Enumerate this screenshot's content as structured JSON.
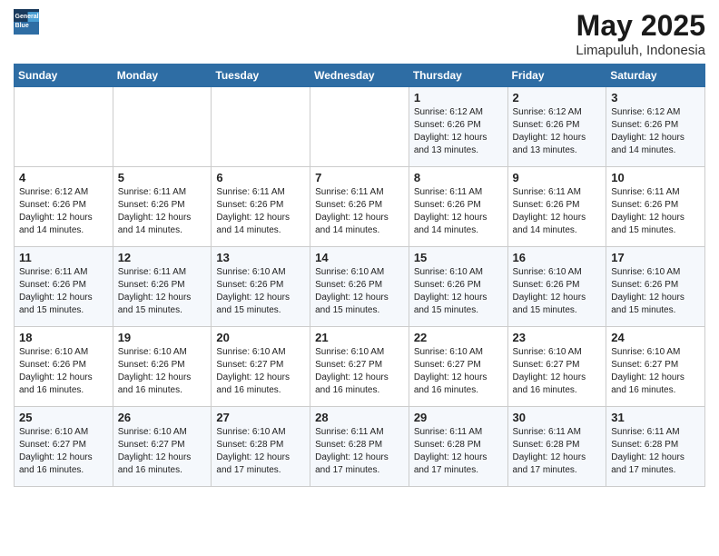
{
  "header": {
    "logo_general": "General",
    "logo_blue": "Blue",
    "month": "May 2025",
    "location": "Limapuluh, Indonesia"
  },
  "days_of_week": [
    "Sunday",
    "Monday",
    "Tuesday",
    "Wednesday",
    "Thursday",
    "Friday",
    "Saturday"
  ],
  "weeks": [
    [
      {
        "day": "",
        "info": ""
      },
      {
        "day": "",
        "info": ""
      },
      {
        "day": "",
        "info": ""
      },
      {
        "day": "",
        "info": ""
      },
      {
        "day": "1",
        "info": "Sunrise: 6:12 AM\nSunset: 6:26 PM\nDaylight: 12 hours\nand 13 minutes."
      },
      {
        "day": "2",
        "info": "Sunrise: 6:12 AM\nSunset: 6:26 PM\nDaylight: 12 hours\nand 13 minutes."
      },
      {
        "day": "3",
        "info": "Sunrise: 6:12 AM\nSunset: 6:26 PM\nDaylight: 12 hours\nand 14 minutes."
      }
    ],
    [
      {
        "day": "4",
        "info": "Sunrise: 6:12 AM\nSunset: 6:26 PM\nDaylight: 12 hours\nand 14 minutes."
      },
      {
        "day": "5",
        "info": "Sunrise: 6:11 AM\nSunset: 6:26 PM\nDaylight: 12 hours\nand 14 minutes."
      },
      {
        "day": "6",
        "info": "Sunrise: 6:11 AM\nSunset: 6:26 PM\nDaylight: 12 hours\nand 14 minutes."
      },
      {
        "day": "7",
        "info": "Sunrise: 6:11 AM\nSunset: 6:26 PM\nDaylight: 12 hours\nand 14 minutes."
      },
      {
        "day": "8",
        "info": "Sunrise: 6:11 AM\nSunset: 6:26 PM\nDaylight: 12 hours\nand 14 minutes."
      },
      {
        "day": "9",
        "info": "Sunrise: 6:11 AM\nSunset: 6:26 PM\nDaylight: 12 hours\nand 14 minutes."
      },
      {
        "day": "10",
        "info": "Sunrise: 6:11 AM\nSunset: 6:26 PM\nDaylight: 12 hours\nand 15 minutes."
      }
    ],
    [
      {
        "day": "11",
        "info": "Sunrise: 6:11 AM\nSunset: 6:26 PM\nDaylight: 12 hours\nand 15 minutes."
      },
      {
        "day": "12",
        "info": "Sunrise: 6:11 AM\nSunset: 6:26 PM\nDaylight: 12 hours\nand 15 minutes."
      },
      {
        "day": "13",
        "info": "Sunrise: 6:10 AM\nSunset: 6:26 PM\nDaylight: 12 hours\nand 15 minutes."
      },
      {
        "day": "14",
        "info": "Sunrise: 6:10 AM\nSunset: 6:26 PM\nDaylight: 12 hours\nand 15 minutes."
      },
      {
        "day": "15",
        "info": "Sunrise: 6:10 AM\nSunset: 6:26 PM\nDaylight: 12 hours\nand 15 minutes."
      },
      {
        "day": "16",
        "info": "Sunrise: 6:10 AM\nSunset: 6:26 PM\nDaylight: 12 hours\nand 15 minutes."
      },
      {
        "day": "17",
        "info": "Sunrise: 6:10 AM\nSunset: 6:26 PM\nDaylight: 12 hours\nand 15 minutes."
      }
    ],
    [
      {
        "day": "18",
        "info": "Sunrise: 6:10 AM\nSunset: 6:26 PM\nDaylight: 12 hours\nand 16 minutes."
      },
      {
        "day": "19",
        "info": "Sunrise: 6:10 AM\nSunset: 6:26 PM\nDaylight: 12 hours\nand 16 minutes."
      },
      {
        "day": "20",
        "info": "Sunrise: 6:10 AM\nSunset: 6:27 PM\nDaylight: 12 hours\nand 16 minutes."
      },
      {
        "day": "21",
        "info": "Sunrise: 6:10 AM\nSunset: 6:27 PM\nDaylight: 12 hours\nand 16 minutes."
      },
      {
        "day": "22",
        "info": "Sunrise: 6:10 AM\nSunset: 6:27 PM\nDaylight: 12 hours\nand 16 minutes."
      },
      {
        "day": "23",
        "info": "Sunrise: 6:10 AM\nSunset: 6:27 PM\nDaylight: 12 hours\nand 16 minutes."
      },
      {
        "day": "24",
        "info": "Sunrise: 6:10 AM\nSunset: 6:27 PM\nDaylight: 12 hours\nand 16 minutes."
      }
    ],
    [
      {
        "day": "25",
        "info": "Sunrise: 6:10 AM\nSunset: 6:27 PM\nDaylight: 12 hours\nand 16 minutes."
      },
      {
        "day": "26",
        "info": "Sunrise: 6:10 AM\nSunset: 6:27 PM\nDaylight: 12 hours\nand 16 minutes."
      },
      {
        "day": "27",
        "info": "Sunrise: 6:10 AM\nSunset: 6:28 PM\nDaylight: 12 hours\nand 17 minutes."
      },
      {
        "day": "28",
        "info": "Sunrise: 6:11 AM\nSunset: 6:28 PM\nDaylight: 12 hours\nand 17 minutes."
      },
      {
        "day": "29",
        "info": "Sunrise: 6:11 AM\nSunset: 6:28 PM\nDaylight: 12 hours\nand 17 minutes."
      },
      {
        "day": "30",
        "info": "Sunrise: 6:11 AM\nSunset: 6:28 PM\nDaylight: 12 hours\nand 17 minutes."
      },
      {
        "day": "31",
        "info": "Sunrise: 6:11 AM\nSunset: 6:28 PM\nDaylight: 12 hours\nand 17 minutes."
      }
    ]
  ]
}
